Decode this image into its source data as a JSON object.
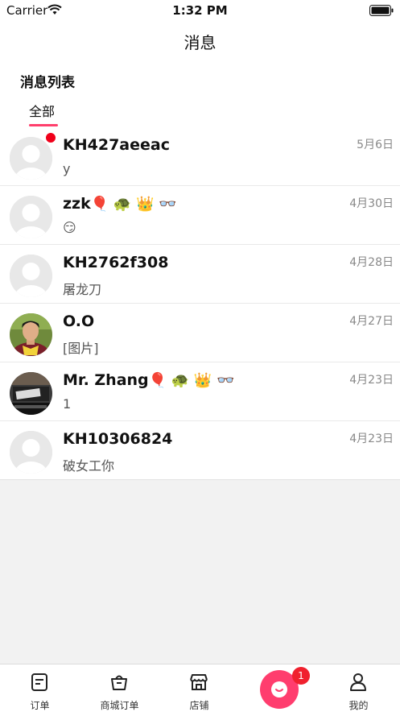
{
  "status_bar": {
    "carrier": "Carrier",
    "time": "1:32 PM"
  },
  "nav": {
    "title": "消息"
  },
  "section": {
    "title": "消息列表",
    "tab_all": "全部"
  },
  "messages": [
    {
      "name": "KH427aeeac",
      "name_emoji": "",
      "preview": "y",
      "date": "5月6日",
      "unread": true,
      "avatar": "default-avatar"
    },
    {
      "name": "zzk",
      "name_emoji": "🎈 🐢 👑 👓",
      "preview": "😏",
      "date": "4月30日",
      "unread": false,
      "avatar": "default-avatar"
    },
    {
      "name": "KH2762f308",
      "name_emoji": "",
      "preview": "屠龙刀",
      "date": "4月28日",
      "unread": false,
      "avatar": "default-avatar"
    },
    {
      "name": "O.O",
      "name_emoji": "",
      "preview": "[图片]",
      "date": "4月27日",
      "unread": false,
      "avatar": "photo-avatar-person"
    },
    {
      "name": "Mr. Zhang",
      "name_emoji": "🎈 🐢 👑 👓",
      "preview": "1",
      "date": "4月23日",
      "unread": false,
      "avatar": "photo-avatar-desk"
    },
    {
      "name": "KH10306824",
      "name_emoji": "",
      "preview": "破女工你",
      "date": "4月23日",
      "unread": false,
      "avatar": "default-avatar"
    }
  ],
  "tabbar": {
    "orders": "订单",
    "mall_orders": "商城订单",
    "store": "店铺",
    "center_badge": "1",
    "mine": "我的"
  },
  "colors": {
    "accent": "#ff3d6e",
    "unread_dot": "#f0001a"
  }
}
